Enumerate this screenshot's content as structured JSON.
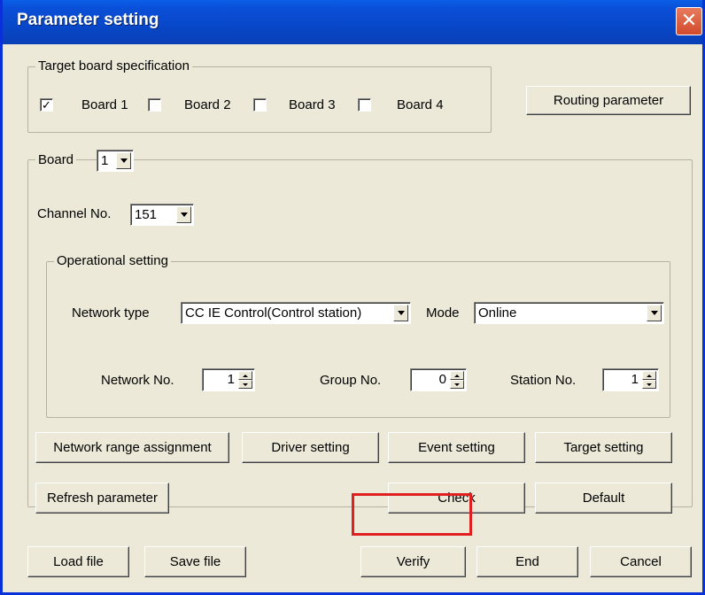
{
  "window": {
    "title": "Parameter setting",
    "close_glyph": "✕"
  },
  "target_board": {
    "legend": "Target board specification",
    "boards": [
      {
        "label": "Board 1",
        "checked": true
      },
      {
        "label": "Board 2",
        "checked": false
      },
      {
        "label": "Board 3",
        "checked": false
      },
      {
        "label": "Board 4",
        "checked": false
      }
    ],
    "check_glyph": "✓",
    "routing_button": "Routing parameter"
  },
  "board": {
    "legend": "Board",
    "selected": "1",
    "channel_label": "Channel No.",
    "channel_value": "151",
    "operational": {
      "legend": "Operational setting",
      "network_type_label": "Network type",
      "network_type_value": "CC IE Control(Control station)",
      "mode_label": "Mode",
      "mode_value": "Online",
      "network_no_label": "Network No.",
      "network_no_value": "1",
      "group_no_label": "Group No.",
      "group_no_value": "0",
      "station_no_label": "Station No.",
      "station_no_value": "1"
    },
    "buttons": {
      "network_range": "Network range assignment",
      "driver_setting": "Driver setting",
      "event_setting": "Event setting",
      "target_setting": "Target setting",
      "refresh_parameter": "Refresh parameter",
      "check": "Check",
      "default": "Default"
    }
  },
  "footer": {
    "load_file": "Load file",
    "save_file": "Save file",
    "verify": "Verify",
    "end": "End",
    "cancel": "Cancel"
  },
  "colors": {
    "highlight": "#e02020",
    "title_bar": "#0a4fd8",
    "dialog_bg": "#ece9d8"
  }
}
